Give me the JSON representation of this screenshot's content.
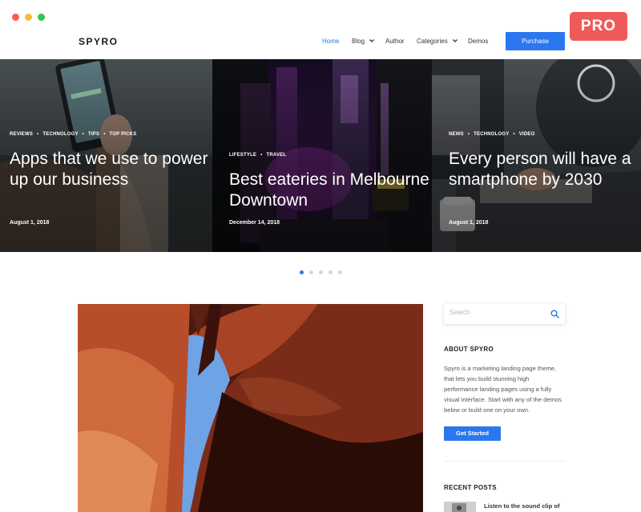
{
  "badge": {
    "label": "PRO"
  },
  "nav": {
    "logo": "SPYRO",
    "items": [
      {
        "label": "Home",
        "active": true
      },
      {
        "label": "Blog",
        "dropdown": true
      },
      {
        "label": "Author"
      },
      {
        "label": "Categories",
        "dropdown": true
      },
      {
        "label": "Demos"
      }
    ],
    "purchase_label": "Purchase"
  },
  "hero": {
    "slides": [
      {
        "categories": [
          "REVIEWS",
          "TECHNOLOGY",
          "TIPS",
          "TOP PICKS"
        ],
        "title": "Apps that we use to power up our business",
        "date": "August 1, 2018"
      },
      {
        "categories": [
          "LIFESTYLE",
          "TRAVEL"
        ],
        "title": "Best eateries in Melbourne Downtown",
        "date": "December 14, 2018"
      },
      {
        "categories": [
          "NEWS",
          "TECHNOLOGY",
          "VIDEO"
        ],
        "title": "Every person will have a smartphone by 2030",
        "date": "August 1, 2018"
      }
    ],
    "pager": {
      "count": 5,
      "active_index": 0
    }
  },
  "sidebar": {
    "search": {
      "placeholder": "Search",
      "icon": "search-icon"
    },
    "about": {
      "title": "ABOUT SPYRO",
      "text": "Spyro is a marketing landing page theme, that lets you build stunning high performance landing pages using a fully visual interface. Start with any of the demos below or build one on your own.",
      "button": "Get Started"
    },
    "recent_posts": {
      "title": "RECENT POSTS",
      "items": [
        {
          "title": "Listen to the sound clip of"
        }
      ]
    }
  },
  "colors": {
    "accent": "#2b77f0",
    "badge": "#f05a5b",
    "traffic_red": "#f25f57",
    "traffic_yellow": "#f6bd3b",
    "traffic_green": "#33c748"
  }
}
